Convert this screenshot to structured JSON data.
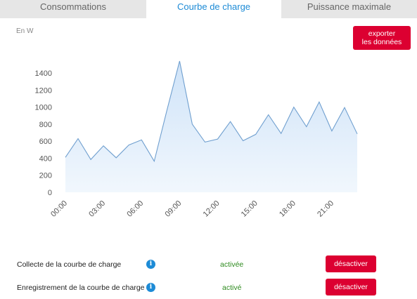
{
  "tabs": [
    {
      "label": "Consommations"
    },
    {
      "label": "Courbe de charge"
    },
    {
      "label": "Puissance maximale"
    }
  ],
  "chart_header": {
    "unit": "En W",
    "export_label_line1": "exporter",
    "export_label_line2": "les données"
  },
  "chart_data": {
    "type": "area",
    "ylabel": "En W",
    "ylim": [
      0,
      1400
    ],
    "yticks": [
      0,
      200,
      400,
      600,
      800,
      1000,
      1200,
      1400
    ],
    "xtick_labels": [
      "00:00",
      "03:00",
      "06:00",
      "09:00",
      "12:00",
      "15:00",
      "18:00",
      "21:00"
    ],
    "x": [
      "00:00",
      "01:00",
      "02:00",
      "03:00",
      "04:00",
      "05:00",
      "06:00",
      "07:00",
      "08:00",
      "09:00",
      "10:00",
      "11:00",
      "12:00",
      "13:00",
      "14:00",
      "15:00",
      "16:00",
      "17:00",
      "18:00",
      "19:00",
      "20:00",
      "21:00",
      "22:00",
      "23:00"
    ],
    "values": [
      410,
      630,
      385,
      545,
      405,
      555,
      615,
      365,
      960,
      1540,
      800,
      590,
      625,
      830,
      605,
      680,
      910,
      690,
      1000,
      770,
      1060,
      720,
      995,
      685
    ],
    "grid": false,
    "legend": "none"
  },
  "settings": [
    {
      "label": "Collecte de la courbe de charge",
      "status": "activée",
      "button": "désactiver"
    },
    {
      "label": "Enregistrement de la courbe de charge",
      "status": "activé",
      "button": "désactiver"
    }
  ],
  "colors": {
    "accent_blue": "#1d8bd6",
    "line_blue": "#6f9fcf",
    "area_top": "#cfe3f8",
    "area_bottom": "#f1f7fd",
    "button_red": "#dc0031",
    "status_green": "#2e8b1f",
    "tab_bg": "#e6e6e6"
  },
  "icons": {
    "info": "info-icon"
  }
}
